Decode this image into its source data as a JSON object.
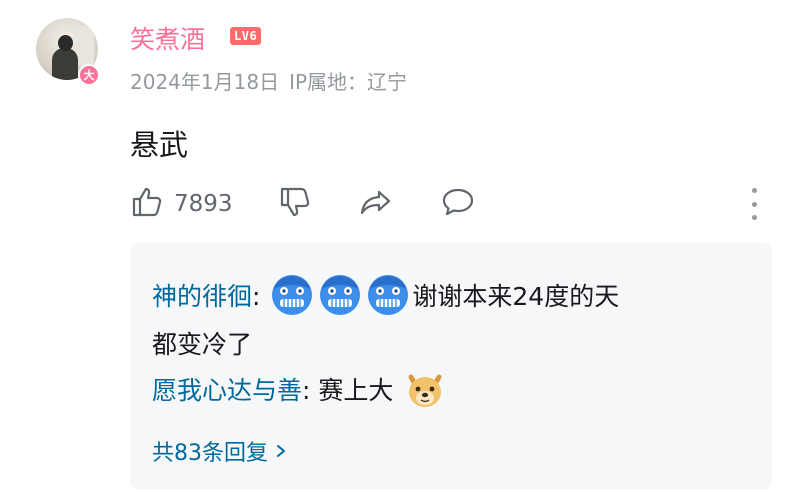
{
  "comment": {
    "username": "笑煮酒",
    "level": "LV6",
    "avatar_badge": "大",
    "date": "2024年1月18日",
    "ip_location": "IP属地：辽宁",
    "text": "悬武",
    "likes": "7893"
  },
  "icons": {
    "like": "thumbs-up-icon",
    "dislike": "thumbs-down-icon",
    "share": "share-icon",
    "reply": "comment-bubble-icon",
    "more": "more-vertical-icon",
    "emote_cold": "freezing-face-emote",
    "emote_doge": "doge-emote",
    "chevron": "chevron-right-icon"
  },
  "colors": {
    "username": "#fb7299",
    "reply_name": "#00699d",
    "level_badge": "#ff6b6b",
    "meta": "#9499a0",
    "reply_bg": "#f6f7f8"
  },
  "replies": [
    {
      "name": "神的徘徊",
      "sep": ":",
      "text_line1": "谢谢本来24度的天",
      "text_line2": "都变冷了"
    },
    {
      "name": "愿我心达与善",
      "sep": ":",
      "text": "赛上大"
    }
  ],
  "more_replies_label": "共83条回复"
}
